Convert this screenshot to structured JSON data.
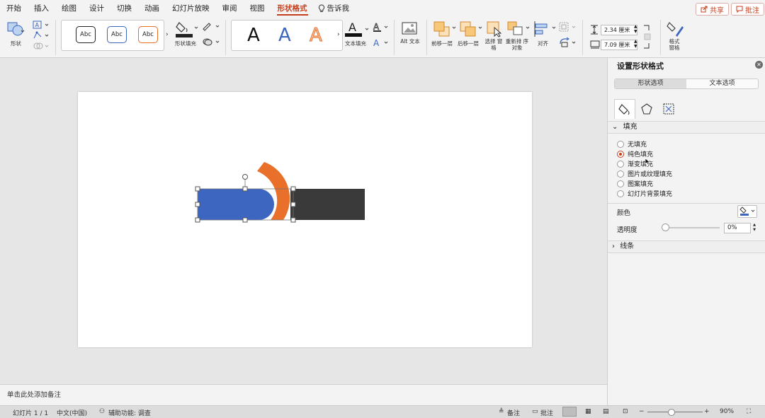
{
  "tabs": [
    "开始",
    "插入",
    "绘图",
    "设计",
    "切换",
    "动画",
    "幻灯片放映",
    "审阅",
    "视图",
    "形状格式"
  ],
  "active_tab": "形状格式",
  "tell_me": "告诉我",
  "share_label": "共享",
  "comments_label": "批注",
  "ribbon": {
    "shape_label": "形状",
    "style_samples": [
      "Abc",
      "Abc",
      "Abc"
    ],
    "shape_fill_label": "形状填充",
    "wordart_samples": [
      "A",
      "A",
      "A"
    ],
    "text_fill_label": "文本填充",
    "alt_text_label": "Alt 文本",
    "bring_forward_label": "前移一层",
    "send_backward_label": "后移一层",
    "selection_pane_label": "选择 窗格",
    "reorder_objects_label": "重新排 序对象",
    "align_label": "对齐",
    "height_value": "2.34 厘米",
    "width_value": "7.09 厘米",
    "format_pane_label": "格式 窗格"
  },
  "slide": {
    "shapes": [
      "blue-rect",
      "orange-arc",
      "dark-rect"
    ]
  },
  "notes_placeholder": "单击此处添加备注",
  "pane": {
    "title": "设置形状格式",
    "seg_shape": "形状选项",
    "seg_text": "文本选项",
    "fill_section": "填充",
    "fill_options": [
      "无填充",
      "纯色填充",
      "渐变填充",
      "图片或纹理填充",
      "图案填充",
      "幻灯片背景填充"
    ],
    "selected_fill": "纯色填充",
    "color_label": "颜色",
    "transparency_label": "透明度",
    "transparency_value": "0%",
    "line_section": "线条"
  },
  "status": {
    "slide_info": "幻灯片 1 / 1",
    "language": "中文(中国)",
    "accessibility": "辅助功能: 调查",
    "notes_btn": "备注",
    "comments_btn": "批注",
    "zoom": "90%"
  },
  "colors": {
    "accent": "#c43e1c",
    "blue_shape": "#3c66c0",
    "orange_shape": "#e8702a",
    "dark_shape": "#3a3a3a"
  }
}
